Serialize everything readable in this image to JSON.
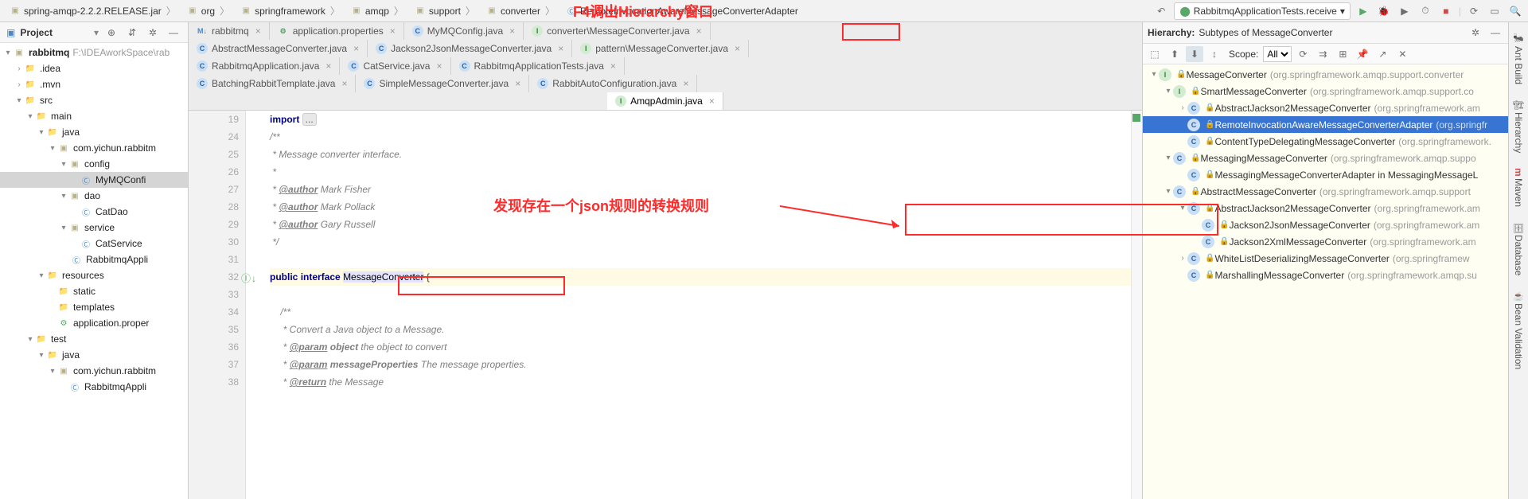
{
  "breadcrumbs": {
    "jar": "spring-amqp-2.2.2.RELEASE.jar",
    "p1": "org",
    "p2": "springframework",
    "p3": "amqp",
    "p4": "support",
    "p5": "converter",
    "cls": "RemoteInvocationAwareMessageConverterAdapter"
  },
  "run_config": "RabbitmqApplicationTests.receive",
  "annotations": {
    "top": "F4调出Hierarchy窗口",
    "mid": "发现存在一个json规则的转换规则"
  },
  "project_panel": {
    "title": "Project",
    "root": "rabbitmq",
    "root_path": "F:\\IDEAworkSpace\\rab",
    "nodes": {
      "idea": ".idea",
      "mvn": ".mvn",
      "src": "src",
      "main": "main",
      "java_main": "java",
      "pkg_main": "com.yichun.rabbitm",
      "config": "config",
      "mymqconfig": "MyMQConfi",
      "dao": "dao",
      "catdao": "CatDao",
      "service": "service",
      "catservice": "CatService",
      "rabbitmqappli": "RabbitmqAppli",
      "resources": "resources",
      "static": "static",
      "templates": "templates",
      "appprops": "application.proper",
      "test": "test",
      "java_test": "java",
      "pkg_test": "com.yichun.rabbitm",
      "rabbitmqappli2": "RabbitmqAppli"
    }
  },
  "tabs": {
    "rabbitmq": "rabbitmq",
    "appprops": "application.properties",
    "mymqconfig": "MyMQConfig.java",
    "msgconverter": "converter\\MessageConverter.java",
    "abstractmsg": "AbstractMessageConverter.java",
    "jackson2json": "Jackson2JsonMessageConverter.java",
    "patternmsg": "pattern\\MessageConverter.java",
    "rabbitmqapp": "RabbitmqApplication.java",
    "catservice": "CatService.java",
    "rabbitmqtests": "RabbitmqApplicationTests.java",
    "batching": "BatchingRabbitTemplate.java",
    "simplemsg": "SimpleMessageConverter.java",
    "autoconfig": "RabbitAutoConfiguration.java",
    "amqpadmin": "AmqpAdmin.java"
  },
  "code": {
    "l19a": "import ",
    "l19b": "...",
    "l24": "/**",
    "l25": " * Message converter interface.",
    "l26": " *",
    "l27a": " * ",
    "l27tag": "@author",
    "l27b": " Mark Fisher",
    "l28a": " * ",
    "l28tag": "@author",
    "l28b": " Mark Pollack",
    "l29a": " * ",
    "l29tag": "@author",
    "l29b": " Gary Russell",
    "l30": " */",
    "l31a": "public",
    "l31b": "interface",
    "l31c": "MessageConverter",
    "l31d": " {",
    "l33": "/**",
    "l34": " * Convert a Java object to a Message.",
    "l35a": " * ",
    "l35tag": "@param",
    "l35b": " object",
    "l35c": " the object to convert",
    "l36a": " * ",
    "l36tag": "@param",
    "l36b": " messageProperties",
    "l36c": " The message properties.",
    "l37a": " * ",
    "l37tag": "@return",
    "l37b": " the Message"
  },
  "line_numbers": [
    "19",
    "24",
    "25",
    "26",
    "27",
    "28",
    "29",
    "30",
    "31",
    "32",
    "33",
    "34",
    "35",
    "36",
    "37",
    "38"
  ],
  "hierarchy": {
    "header_label": "Hierarchy:",
    "header_value": "Subtypes of MessageConverter",
    "scope_label": "Scope:",
    "scope_value": "All",
    "items": [
      {
        "indent": 0,
        "arrow": "v",
        "icon": "interface",
        "name": "MessageConverter",
        "pkg": "(org.springframework.amqp.support.converter",
        "selected": false,
        "lock": true
      },
      {
        "indent": 1,
        "arrow": "v",
        "icon": "interface",
        "name": "SmartMessageConverter",
        "pkg": "(org.springframework.amqp.support.co",
        "selected": false,
        "lock": true
      },
      {
        "indent": 2,
        "arrow": ">",
        "icon": "class",
        "name": "AbstractJackson2MessageConverter",
        "pkg": "(org.springframework.am",
        "selected": false,
        "lock": true
      },
      {
        "indent": 2,
        "arrow": "",
        "icon": "class",
        "name": "RemoteInvocationAwareMessageConverterAdapter",
        "pkg": "(org.springfr",
        "selected": true,
        "lock": true
      },
      {
        "indent": 2,
        "arrow": "",
        "icon": "class",
        "name": "ContentTypeDelegatingMessageConverter",
        "pkg": "(org.springframework.",
        "selected": false,
        "lock": true
      },
      {
        "indent": 1,
        "arrow": "v",
        "icon": "class",
        "name": "MessagingMessageConverter",
        "pkg": "(org.springframework.amqp.suppo",
        "selected": false,
        "lock": true
      },
      {
        "indent": 2,
        "arrow": "",
        "icon": "class",
        "name": "MessagingMessageConverterAdapter in MessagingMessageL",
        "pkg": "",
        "selected": false,
        "lock": true
      },
      {
        "indent": 1,
        "arrow": "v",
        "icon": "class",
        "name": "AbstractMessageConverter",
        "pkg": "(org.springframework.amqp.support",
        "selected": false,
        "lock": true
      },
      {
        "indent": 2,
        "arrow": "v",
        "icon": "class",
        "name": "AbstractJackson2MessageConverter",
        "pkg": "(org.springframework.am",
        "selected": false,
        "lock": true,
        "boxed": true
      },
      {
        "indent": 3,
        "arrow": "",
        "icon": "class",
        "name": "Jackson2JsonMessageConverter",
        "pkg": "(org.springframework.am",
        "selected": false,
        "lock": true,
        "boxed": true
      },
      {
        "indent": 3,
        "arrow": "",
        "icon": "class",
        "name": "Jackson2XmlMessageConverter",
        "pkg": "(org.springframework.am",
        "selected": false,
        "lock": true
      },
      {
        "indent": 2,
        "arrow": ">",
        "icon": "class",
        "name": "WhiteListDeserializingMessageConverter",
        "pkg": "(org.springframew",
        "selected": false,
        "lock": true
      },
      {
        "indent": 2,
        "arrow": "",
        "icon": "class",
        "name": "MarshallingMessageConverter",
        "pkg": "(org.springframework.amqp.su",
        "selected": false,
        "lock": true
      }
    ]
  },
  "right_gutter": {
    "ant": "Ant Build",
    "hier": "Hierarchy",
    "maven": "Maven",
    "db": "Database",
    "bean": "Bean Validation"
  }
}
